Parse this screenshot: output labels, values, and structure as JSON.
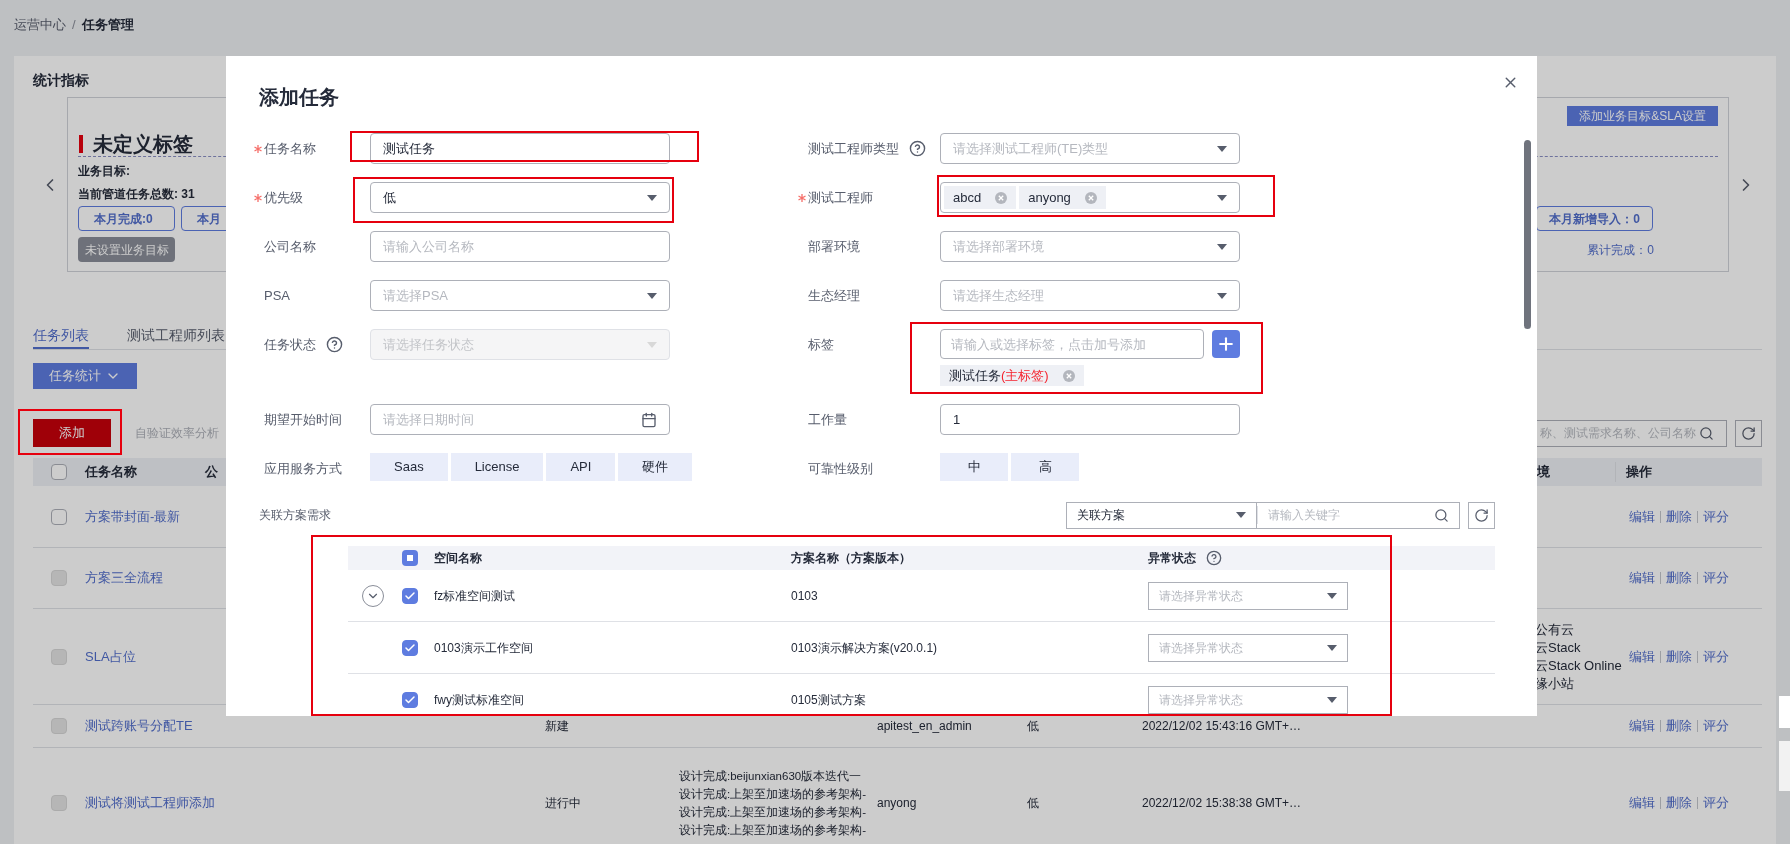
{
  "breadcrumb": {
    "items": [
      {
        "label": "运营中心",
        "current": false
      },
      {
        "label": "任务管理",
        "current": true
      }
    ],
    "separator": "/"
  },
  "stats": {
    "title": "统计指标",
    "card": {
      "title": "未定义标签",
      "goal_label": "业务目标:",
      "total": "当前管道任务总数: 31",
      "left_buttons": [
        "本月完成:0",
        "本月"
      ],
      "unset_button": "未设置业务目标",
      "add_button": "添加业务目标&SLA设置",
      "right_button": "本月新增导入：0",
      "cumulative": "累计完成：0"
    }
  },
  "tabs": [
    {
      "label": "任务列表",
      "selected": true
    },
    {
      "label": "测试工程师列表",
      "selected": false
    }
  ],
  "stats_dropdown": "任务统计",
  "add_button": "添加",
  "efficiency_link": "自验证效率分析",
  "search": {
    "placeholder": "称、测试需求名称、公司名称"
  },
  "table": {
    "all_checked": false,
    "columns": [
      "任务名称",
      "公",
      "境",
      "操作"
    ],
    "rows": [
      {
        "name": "方案带封面-最新",
        "disabled": false,
        "actions": [
          "编辑",
          "删除",
          "评分"
        ]
      },
      {
        "name": "方案三全流程",
        "disabled": true,
        "actions": [
          "编辑",
          "删除",
          "评分"
        ]
      },
      {
        "name": "SLA占位",
        "disabled": true,
        "environment": [
          "公有云",
          "云Stack",
          "云Stack Online",
          "缘小站"
        ],
        "actions": [
          "编辑",
          "删除",
          "评分"
        ]
      },
      {
        "name": "测试跨账号分配TE",
        "disabled": true,
        "status": "新建",
        "owner": "apitest_en_admin",
        "priority": "低",
        "created": "2022/12/02 15:43:16 GMT+…",
        "actions": [
          "编辑",
          "删除",
          "评分"
        ]
      },
      {
        "name": "测试将测试工程师添加",
        "disabled": true,
        "status": "进行中",
        "design": [
          "设计完成:beijunxian630版本迭代一",
          "设计完成:上架至加速场的参考架构-",
          "设计完成:上架至加速场的参考架构-",
          "设计完成:上架至加速场的参考架构-"
        ],
        "owner": "anyong",
        "priority": "低",
        "created": "2022/12/02 15:38:38 GMT+…",
        "actions": [
          "编辑",
          "删除",
          "评分"
        ]
      }
    ]
  },
  "dialog": {
    "title": "添加任务",
    "form": {
      "left": [
        {
          "label": "任务名称",
          "required": true,
          "kind": "input",
          "value": "测试任务"
        },
        {
          "label": "优先级",
          "required": true,
          "kind": "select",
          "value": "低",
          "disabled": false
        },
        {
          "label": "公司名称",
          "kind": "input",
          "placeholder": "请输入公司名称"
        },
        {
          "label": "PSA",
          "kind": "select",
          "placeholder": "请选择PSA",
          "disabled": false
        },
        {
          "label": "任务状态",
          "help": true,
          "kind": "select",
          "placeholder": "请选择任务状态",
          "disabled": true
        },
        {
          "label": "期望开始时间",
          "kind": "date",
          "placeholder": "请选择日期时间"
        },
        {
          "label": "应用服务方式",
          "kind": "segments",
          "options": [
            "Saas",
            "License",
            "API",
            "硬件"
          ]
        }
      ],
      "right": [
        {
          "label": "测试工程师类型",
          "help": true,
          "kind": "select",
          "placeholder": "请选择测试工程师(TE)类型",
          "disabled": false
        },
        {
          "label": "测试工程师",
          "required": true,
          "kind": "multiselect",
          "tags": [
            "abcd",
            "anyong"
          ]
        },
        {
          "label": "部署环境",
          "kind": "select",
          "placeholder": "请选择部署环境",
          "disabled": false
        },
        {
          "label": "生态经理",
          "kind": "select",
          "placeholder": "请选择生态经理",
          "disabled": false
        },
        {
          "label": "标签",
          "kind": "tag-input",
          "placeholder": "请输入或选择标签，点击加号添加",
          "tags": [
            {
              "text": "测试任务",
              "note": "(主标签)"
            }
          ]
        },
        {
          "label": "工作量",
          "kind": "input",
          "value": "1"
        },
        {
          "label": "可靠性级别",
          "kind": "segments",
          "options": [
            "中",
            "高"
          ]
        }
      ]
    },
    "linked": {
      "label": "关联方案需求",
      "filter": "关联方案",
      "keyword_placeholder": "请输入关键字"
    },
    "plans": {
      "all_checked": true,
      "partial": true,
      "columns": [
        "空间名称",
        "方案名称（方案版本）",
        "异常状态"
      ],
      "rows": [
        {
          "space": "fz标准空间测试",
          "plan": "0103",
          "status_placeholder": "请选择异常状态",
          "checked": true,
          "expandable": true
        },
        {
          "space": "0103演示工作空间",
          "plan": "0103演示解决方案(v20.0.1)",
          "status_placeholder": "请选择异常状态",
          "checked": true,
          "expandable": false
        },
        {
          "space": "fwy测试标准空间",
          "plan": "0105测试方案",
          "status_placeholder": "请选择异常状态",
          "checked": true,
          "expandable": false
        }
      ]
    }
  }
}
